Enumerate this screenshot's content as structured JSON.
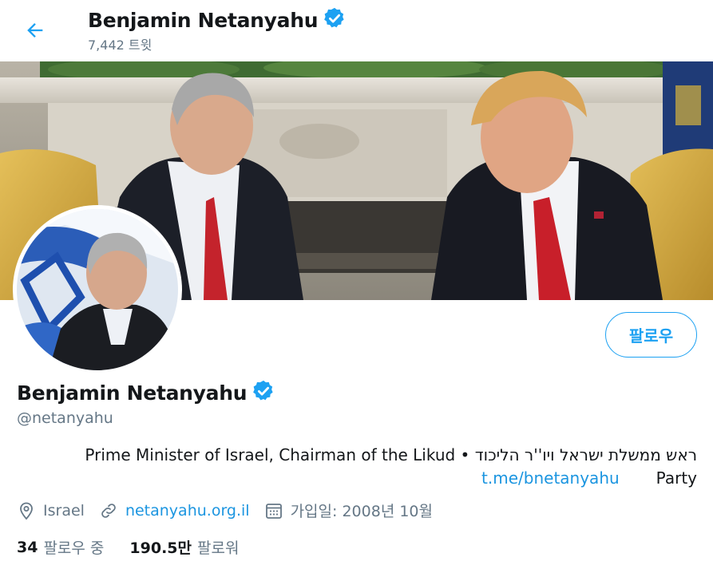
{
  "header": {
    "name": "Benjamin Netanyahu",
    "tweet_count": "7,442 트윗"
  },
  "profile": {
    "name": "Benjamin Netanyahu",
    "handle": "@netanyahu",
    "follow_label": "팔로우",
    "bio_line1": "Prime Minister of Israel, Chairman of the Likud  •  ראש ממשלת ישראל ויו''ר הליכוד",
    "bio_link": "t.me/bnetanyahu",
    "bio_line2_tail": "Party",
    "location": "Israel",
    "website": "netanyahu.org.il",
    "joined": "가입일: 2008년 10월",
    "following_count": "34",
    "following_label": "팔로우 중",
    "followers_count": "190.5만",
    "followers_label": "팔로워"
  },
  "colors": {
    "accent": "#1da1f2",
    "link": "#1b95e0",
    "secondary_text": "#657786"
  },
  "icons": [
    "back-arrow-icon",
    "verified-badge-icon",
    "location-pin-icon",
    "link-icon",
    "calendar-icon"
  ]
}
